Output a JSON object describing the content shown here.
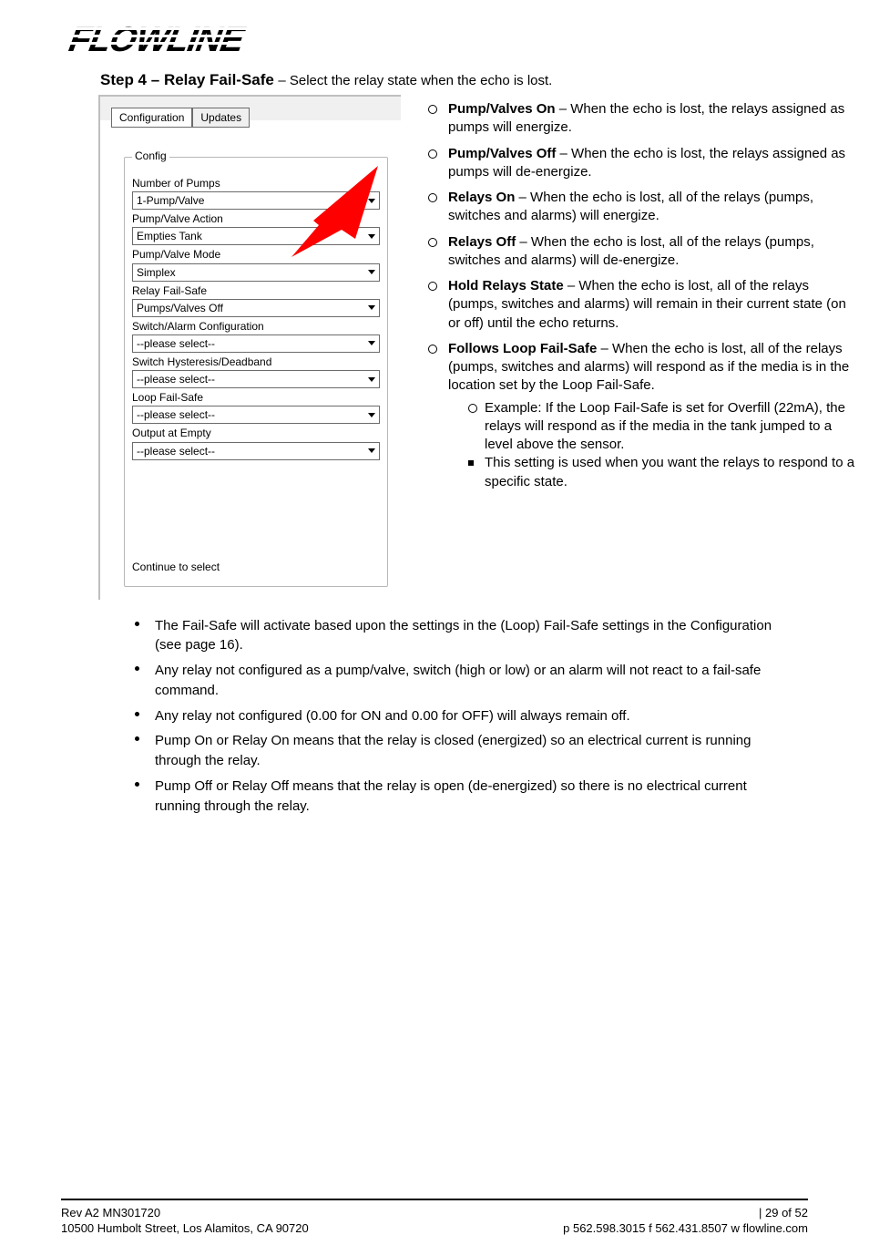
{
  "logo_text": "FLOWLINE",
  "step": {
    "number": "Step 4",
    "title": "Relay Fail-Safe",
    "desc": "Select the relay state when the echo is lost."
  },
  "config_panel": {
    "tab_active": "Configuration",
    "tab_inactive": "Updates",
    "group": "Config",
    "fields": [
      {
        "label": "Number of Pumps",
        "value": "1-Pump/Valve"
      },
      {
        "label": "Pump/Valve Action",
        "value": "Empties Tank"
      },
      {
        "label": "Pump/Valve Mode",
        "value": "Simplex"
      },
      {
        "label": "Relay Fail-Safe",
        "value": "Pumps/Valves Off"
      },
      {
        "label": "Switch/Alarm Configuration",
        "value": "--please select--"
      },
      {
        "label": "Switch Hysteresis/Deadband",
        "value": "--please select--"
      },
      {
        "label": "Loop Fail-Safe",
        "value": "--please select--"
      },
      {
        "label": "Output at Empty",
        "value": "--please select--"
      }
    ],
    "continue": "Continue to select"
  },
  "rhs": [
    {
      "t": "Pump/Valves On – When the echo is lost, the relays assigned as pumps will energize."
    },
    {
      "t": "Pump/Valves Off – When the echo is lost, the relays assigned as pumps will de-energize."
    },
    {
      "t": "Relays On – When the echo is lost, all of the relays (pumps, switches and alarms) will energize."
    },
    {
      "t": "Relays Off – When the echo is lost, all of the relays (pumps, switches and alarms) will de-energize."
    },
    {
      "t": "Hold Relays State – When the echo is lost, all of the relays (pumps, switches and alarms) will remain in their current state (on or off) until the echo returns."
    },
    {
      "t": "Follows Loop Fail-Safe – When the echo is lost, all of the relays (pumps, switches and alarms) will respond as if the media is in the location set by the Loop Fail-Safe.",
      "sub": [
        {
          "txt": "Example: If the Loop Fail-Safe is set for Overfill (22mA), the relays will respond as if the media in the tank jumped to a level above the sensor.",
          "square": false
        },
        {
          "txt": "This setting is used when you want the relays to respond to a specific state.",
          "square": true
        }
      ]
    }
  ],
  "notes": [
    "The Fail-Safe will activate based upon the settings in the (Loop) Fail-Safe settings in the Configuration (see page 16).",
    "Any relay not configured as a pump/valve, switch (high or low) or an alarm will not react to a fail-safe command.",
    "Any relay not configured (0.00 for ON and 0.00 for OFF) will always remain off.",
    "Pump On or Relay On means that the relay is closed (energized) so an electrical current is running through the relay.",
    "Pump Off or Relay Off means that the relay is open (de-energized) so there is no electrical current running through the relay."
  ],
  "footer": {
    "l1_left": "",
    "l1_right": "| 29 of 52",
    "l2_left": "",
    "l2_right": ""
  },
  "foot_left": "Rev A2   MN301720",
  "foot_addr": "10500 Humbolt Street, Los Alamitos, CA 90720",
  "foot_phone": "p 562.598.3015   f 562.431.8507   w flowline.com"
}
